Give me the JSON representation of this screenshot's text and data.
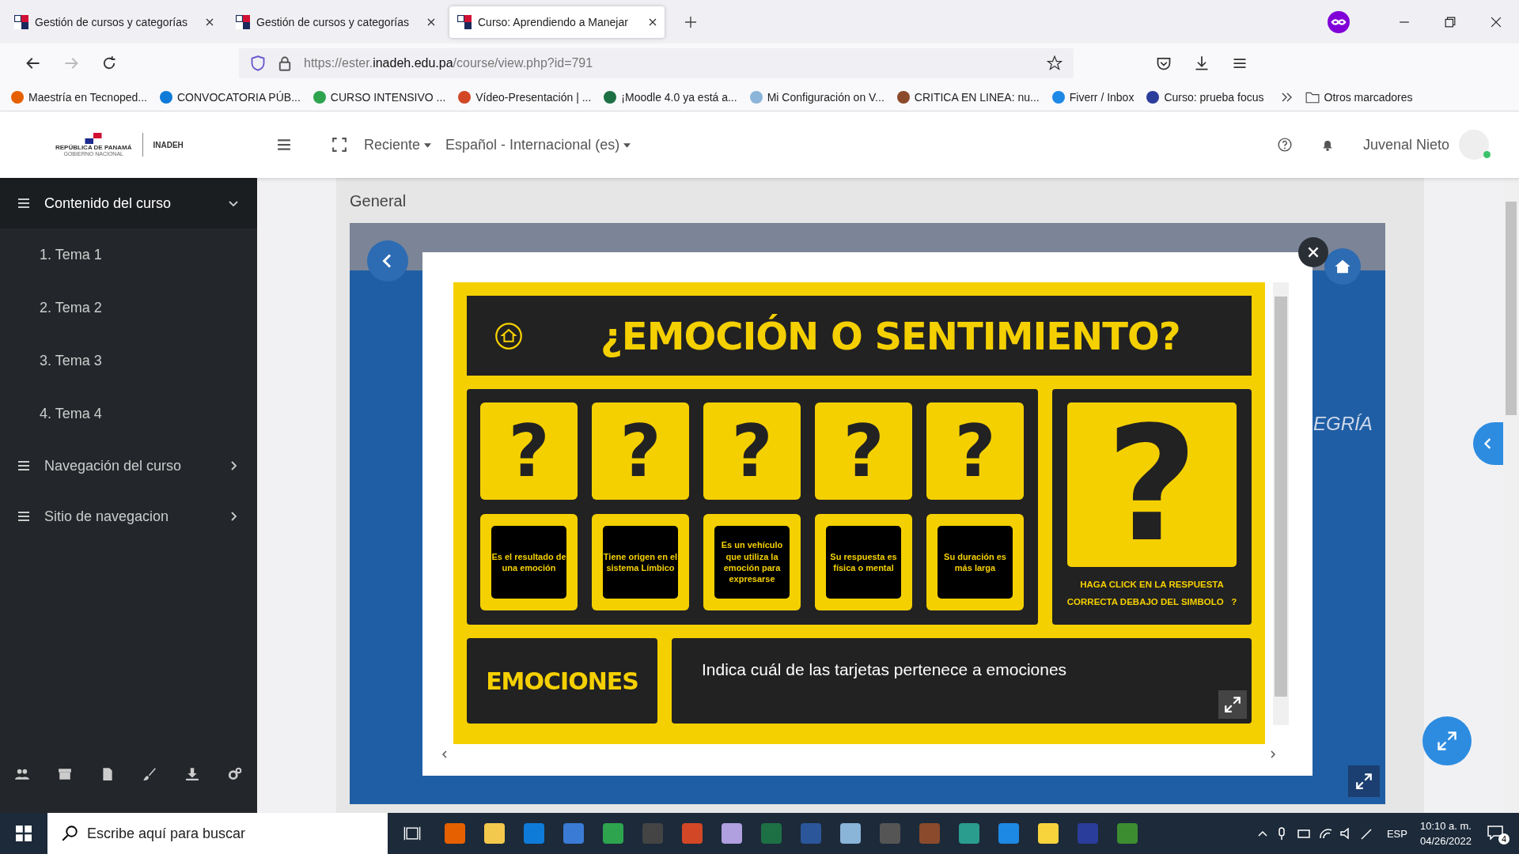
{
  "browser": {
    "tabs": [
      {
        "title": "Gestión de cursos y categorías",
        "selected": false
      },
      {
        "title": "Gestión de cursos y categorías",
        "selected": false
      },
      {
        "title": "Curso: Aprendiendo a Manejar",
        "selected": true
      }
    ],
    "url": {
      "prefix": "https://ester.",
      "host": "inadeh.edu.pa",
      "path": "/course/view.php?id=791"
    },
    "bookmarks": [
      {
        "label": "Maestría en Tecnoped..."
      },
      {
        "label": "CONVOCATORIA PÚB..."
      },
      {
        "label": "CURSO INTENSIVO ..."
      },
      {
        "label": "Vídeo-Presentación | ..."
      },
      {
        "label": "¡Moodle 4.0 ya está a..."
      },
      {
        "label": "Mi Configuración on V..."
      },
      {
        "label": "CRITICA EN LINEA: nu..."
      },
      {
        "label": "Fiverr / Inbox"
      },
      {
        "label": "Curso: prueba focus"
      }
    ],
    "other_bookmarks": "Otros marcadores"
  },
  "header": {
    "logo_title": "REPÚBLICA DE PANAMÁ",
    "logo_subtitle": "GOBIERNO NACIONAL",
    "logo_org": "INADEH",
    "menus": [
      {
        "label": "Reciente"
      },
      {
        "label": "Español - Internacional (es)"
      }
    ],
    "user": "Juvenal Nieto"
  },
  "sidebar": {
    "sections": [
      {
        "label": "Contenido del curso",
        "expanded": true,
        "children": [
          {
            "label": "1. Tema 1"
          },
          {
            "label": "2. Tema 2"
          },
          {
            "label": "3. Tema 3"
          },
          {
            "label": "4. Tema 4"
          }
        ]
      },
      {
        "label": "Navegación del curso",
        "expanded": false
      },
      {
        "label": "Sitio de navegacion",
        "expanded": false
      }
    ]
  },
  "main": {
    "section_title": "General",
    "background_text": "EGRÍA",
    "game": {
      "title": "¿EMOCIÓN O SENTIMIENTO?",
      "cards": [
        {
          "symbol": "?",
          "text": "Es el resultado de una emoción"
        },
        {
          "symbol": "?",
          "text": "Tiene origen en el sistema Límbico"
        },
        {
          "symbol": "?",
          "text": "Es un vehículo que  utiliza la emoción para expresarse"
        },
        {
          "symbol": "?",
          "text": "Su respuesta es física o mental"
        },
        {
          "symbol": "?",
          "text": "Su duración es más larga"
        }
      ],
      "big_symbol": "?",
      "instruction": "HAGA CLICK EN LA RESPUESTA CORRECTA DEBAJO DEL SIMBOLO   ?",
      "category": "EMOCIONES",
      "prompt": "Indica cuál de las tarjetas pertenece a emociones"
    }
  },
  "taskbar": {
    "search_placeholder": "Escribe aquí para buscar",
    "language": "ESP",
    "time": "10:10 a. m.",
    "date": "04/26/2022",
    "notifications": "4"
  }
}
